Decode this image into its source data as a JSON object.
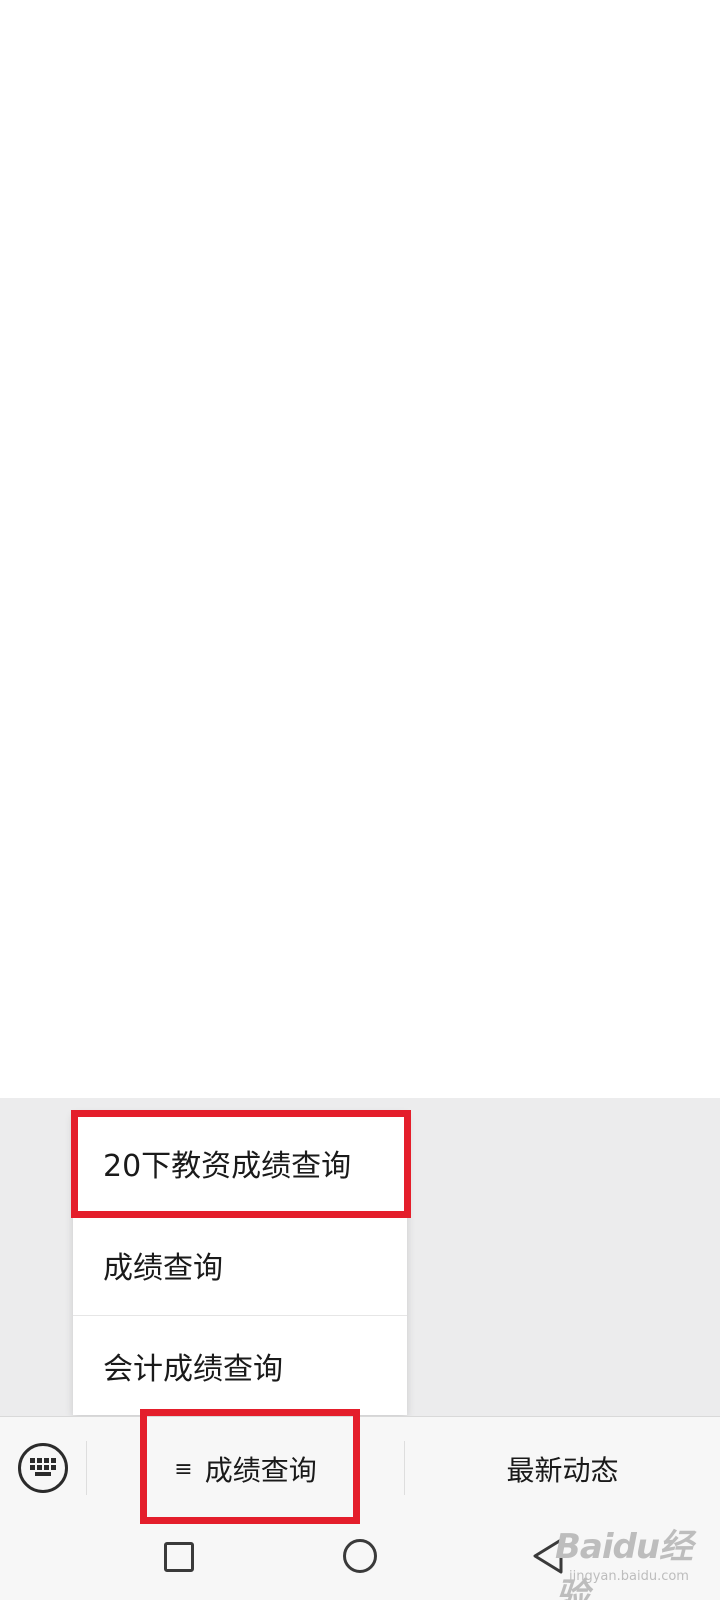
{
  "popup_menu": {
    "items": [
      {
        "label": "20下教资成绩查询"
      },
      {
        "label": "成绩查询"
      },
      {
        "label": "会计成绩查询"
      }
    ]
  },
  "menu_bar": {
    "keyboard_icon": "keyboard-icon",
    "tabs": [
      {
        "label": "成绩查询",
        "prefix": "≡"
      },
      {
        "label": "最新动态"
      }
    ]
  },
  "nav_bar": {
    "icons": [
      "recent-apps-icon",
      "home-icon",
      "back-icon"
    ]
  },
  "watermark": {
    "logo": "Baidu经验",
    "sub": "jingyan.baidu.com"
  },
  "colors": {
    "highlight": "#e41e2b",
    "gray_bg": "#ececed",
    "bar_bg": "#f7f7f7"
  }
}
